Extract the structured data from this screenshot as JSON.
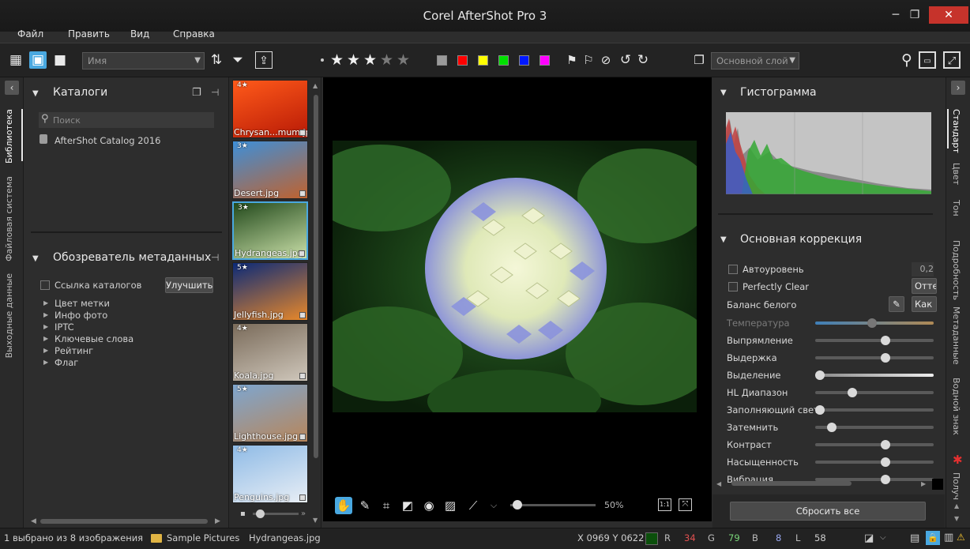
{
  "app": {
    "title": "Corel AfterShot Pro 3",
    "win_min": "─",
    "win_max": "❐",
    "win_close": "✕"
  },
  "menu": [
    "Файл",
    "Править",
    "Вид",
    "Справка"
  ],
  "toolbar": {
    "sort_value": "Имя",
    "layer_value": "Основной слой",
    "rating_stars": 3,
    "colors": [
      "#9a9a9a",
      "#ff0000",
      "#ffff00",
      "#00e000",
      "#0018ff",
      "#ff00ff"
    ],
    "icons": {
      "grid": "▦",
      "fit": "▣",
      "single": "■",
      "sort": "⇅",
      "filter": "⏷",
      "export": "⇪",
      "flag1": "⚑",
      "flag2": "⚐",
      "noflag": "⊘",
      "undo": "↺",
      "redo": "↻",
      "copy": "❐",
      "search": "⚲",
      "monitor": "▭",
      "fullscreen": "⤢"
    }
  },
  "left_tabs": [
    "Библиотека",
    "Файловая система",
    "Выходные данные"
  ],
  "library": {
    "catalogs_title": "Каталоги",
    "search_placeholder": "Поиск",
    "catalog_item": "AfterShot Catalog 2016",
    "meta_title": "Обозреватель метаданных",
    "catalog_link": "Ссылка каталогов",
    "improve": "Улучшить",
    "meta_items": [
      "Цвет метки",
      "Инфо фото",
      "IPTC",
      "Ключевые слова",
      "Рейтинг",
      "Флаг"
    ]
  },
  "filmstrip": [
    {
      "name": "Chrysan...mum.jpg",
      "rating": "4★",
      "colors": [
        "#ff5a1a",
        "#b81a06"
      ]
    },
    {
      "name": "Desert.jpg",
      "rating": "3★",
      "colors": [
        "#3e8fd8",
        "#c0622e"
      ]
    },
    {
      "name": "Hydrangeas.jpg",
      "rating": "3★",
      "colors": [
        "#234a1c",
        "#c9dfa8"
      ]
    },
    {
      "name": "Jellyfish.jpg",
      "rating": "5★",
      "colors": [
        "#0b2a78",
        "#e8882a"
      ]
    },
    {
      "name": "Koala.jpg",
      "rating": "4★",
      "colors": [
        "#7a6b5a",
        "#cfc7bb"
      ]
    },
    {
      "name": "Lighthouse.jpg",
      "rating": "5★",
      "colors": [
        "#7ea6cf",
        "#b8865a"
      ]
    },
    {
      "name": "Penguins.jpg",
      "rating": "4★",
      "colors": [
        "#8fbbe6",
        "#e8eef5"
      ]
    }
  ],
  "viewer": {
    "zoom": "50%",
    "zoom_level": 0.03,
    "one_to_one": "1:1"
  },
  "histogram_title": "Гистограмма",
  "correction": {
    "title": "Основная коррекция",
    "autolevel": "Автоуровень",
    "autolevel_val": "0,2",
    "perfect_clear": "Perfectly Clear",
    "pc_btn": "Отте",
    "white_balance": "Баланс белого",
    "wb_btn": "Как с",
    "sliders": [
      {
        "label": "Температура",
        "level": 0.48,
        "dim": true
      },
      {
        "label": "Выпрямление",
        "level": 0.59
      },
      {
        "label": "Выдержка",
        "level": 0.59
      },
      {
        "label": "Выделение",
        "level": 0.04
      },
      {
        "label": "HL Диапазон",
        "level": 0.31
      },
      {
        "label": "Заполняющий свет",
        "level": 0.04
      },
      {
        "label": "Затемнить",
        "level": 0.14
      },
      {
        "label": "Контраст",
        "level": 0.59
      },
      {
        "label": "Насыщенность",
        "level": 0.59
      },
      {
        "label": "Вибрация",
        "level": 0.59
      }
    ],
    "reset": "Сбросить все"
  },
  "right_tabs": [
    "Стандарт",
    "Цвет",
    "Тон",
    "Подробность",
    "Метаданные",
    "Водной знак",
    "Получ"
  ],
  "status": {
    "selected": "1 выбрано из 8 изображения",
    "folder": "Sample Pictures",
    "file": "Hydrangeas.jpg",
    "coords": "X 0969  Y 0622",
    "r_label": "R",
    "r": "34",
    "g_label": "G",
    "g": "79",
    "b_label": "B",
    "b": "8",
    "l_label": "L",
    "l": "58",
    "pixel_color": "#0b4f0b"
  }
}
